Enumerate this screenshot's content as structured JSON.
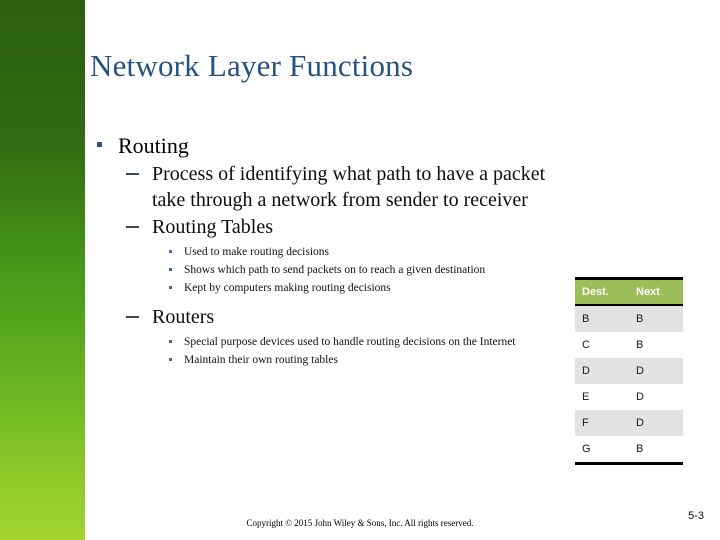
{
  "slide": {
    "title": "Network Layer Functions",
    "number": "5-3",
    "footer": "Copyright © 2015 John Wiley & Sons, Inc. All rights reserved.",
    "accent_green_top": "#2c6010",
    "accent_green_bottom": "#a2d230",
    "title_color": "#255381",
    "table_header_green": "#9dbd58"
  },
  "content": {
    "level1": {
      "label": "Routing"
    },
    "level2": [
      {
        "label": "Process of identifying what path to have a packet take through a network from sender to receiver",
        "children": []
      },
      {
        "label": "Routing Tables",
        "children": [
          "Used to make routing decisions",
          "Shows which path to send packets on to reach a given destination",
          "Kept by computers making routing decisions"
        ]
      },
      {
        "label": "Routers",
        "children": [
          "Special purpose devices used to handle routing decisions on the Internet",
          "Maintain their own routing tables"
        ]
      }
    ]
  },
  "routing_table": {
    "headers": [
      "Dest.",
      "Next"
    ],
    "rows": [
      [
        "B",
        "B"
      ],
      [
        "C",
        "B"
      ],
      [
        "D",
        "D"
      ],
      [
        "E",
        "D"
      ],
      [
        "F",
        "D"
      ],
      [
        "G",
        "B"
      ]
    ]
  }
}
